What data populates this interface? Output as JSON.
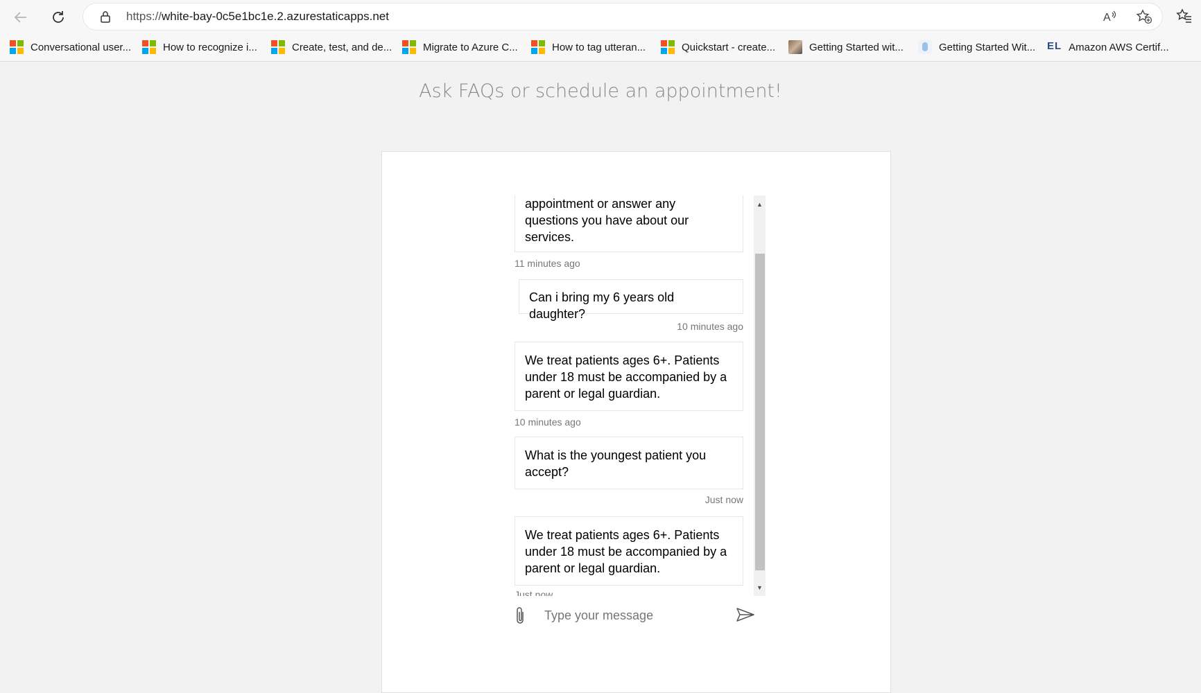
{
  "browser": {
    "url_scheme": "https://",
    "url_host": "white-bay-0c5e1bc1e.2.azurestaticapps.net",
    "icons": [
      "back-arrow-icon",
      "refresh-icon",
      "lock-icon",
      "read-aloud-icon",
      "add-favorite-icon",
      "collections-icon"
    ]
  },
  "bookmarks": [
    {
      "label": "Conversational user...",
      "icon": "microsoft-logo-icon"
    },
    {
      "label": "How to recognize i...",
      "icon": "microsoft-logo-icon"
    },
    {
      "label": "Create, test, and de...",
      "icon": "microsoft-logo-icon"
    },
    {
      "label": "Migrate to Azure C...",
      "icon": "microsoft-logo-icon"
    },
    {
      "label": "How to tag utteran...",
      "icon": "microsoft-logo-icon"
    },
    {
      "label": "Quickstart - create...",
      "icon": "microsoft-logo-icon"
    },
    {
      "label": "Getting Started wit...",
      "icon": "thumbnail-icon"
    },
    {
      "label": "Getting Started Wit...",
      "icon": "page-icon"
    },
    {
      "label": "Amazon AWS Certif...",
      "icon": "el-logo-icon",
      "logo_text": "EL"
    }
  ],
  "page": {
    "title": "Ask FAQs or schedule an appointment!"
  },
  "chat": {
    "messages": [
      {
        "from": "bot",
        "text_lines": [
          "appointment or answer any",
          "questions you have about our",
          "services."
        ],
        "time": "11 minutes ago"
      },
      {
        "from": "user",
        "text_lines": [
          "Can i bring my 6 years old daughter?"
        ],
        "time": "10 minutes ago"
      },
      {
        "from": "bot",
        "text_lines": [
          "We treat patients ages 6+. Patients",
          "under 18 must be accompanied by a",
          "parent or legal guardian."
        ],
        "time": "10 minutes ago"
      },
      {
        "from": "user",
        "text_lines": [
          "What is the youngest patient you",
          "accept?"
        ],
        "time": "Just now"
      },
      {
        "from": "bot",
        "text_lines": [
          "We treat patients ages 6+. Patients",
          "under 18 must be accompanied by a",
          "parent or legal guardian."
        ],
        "time": "Just now"
      }
    ],
    "input_placeholder": "Type your message"
  },
  "colors": {
    "page_bg": "#f2f2f2",
    "card_bg": "#ffffff",
    "bubble_border": "#e6e6e6",
    "timestamp": "#767676",
    "scroll_thumb": "#c1c1c1"
  }
}
